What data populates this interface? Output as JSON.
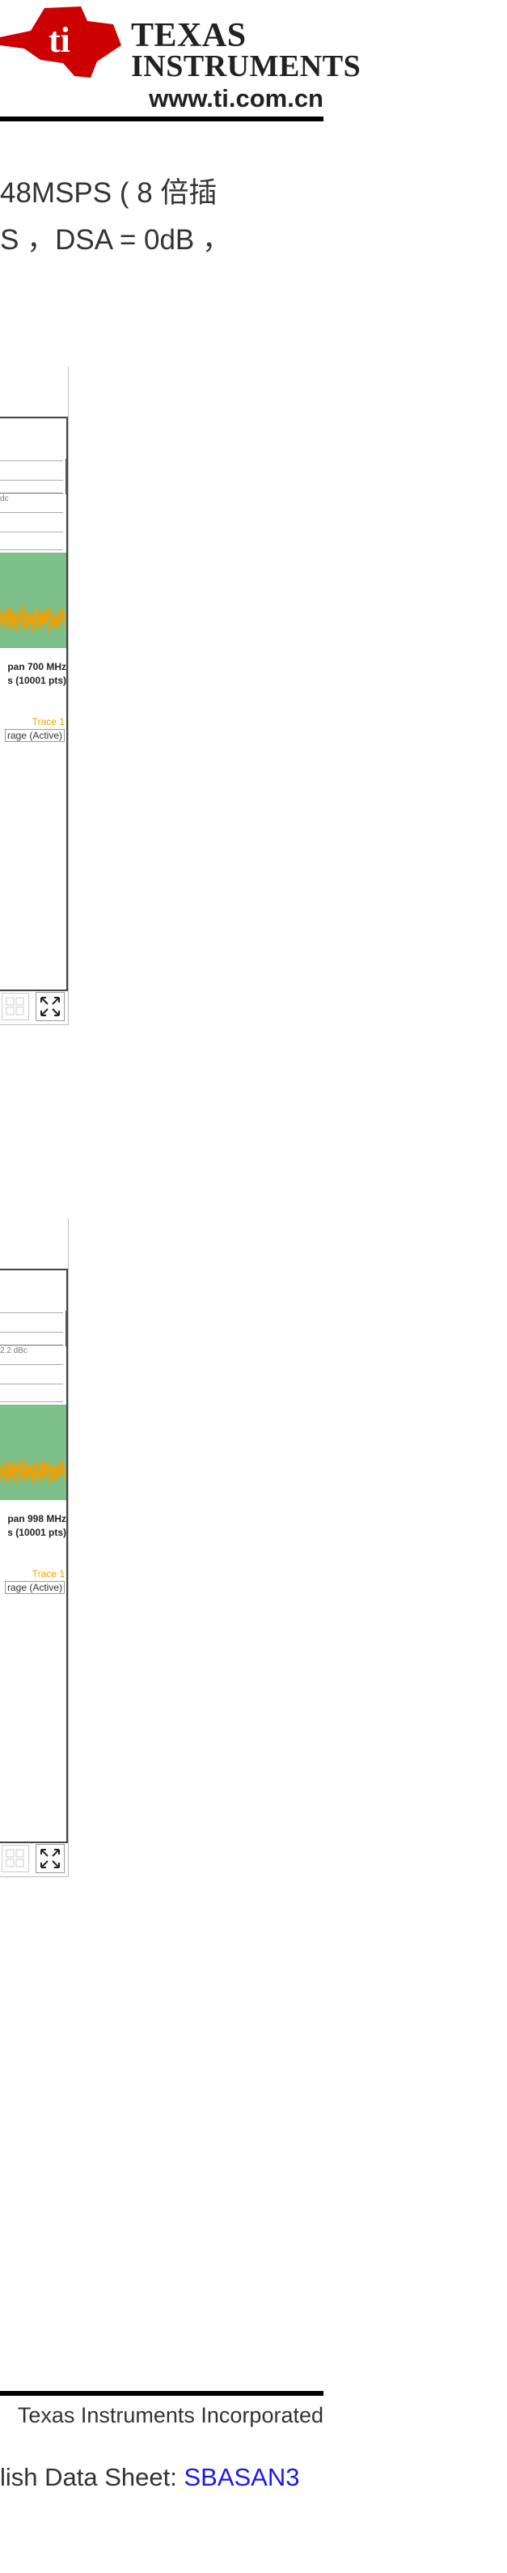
{
  "header": {
    "logo_line1": "TEXAS",
    "logo_line2": "INSTRUMENTS",
    "url": "www.ti.com.cn"
  },
  "body_text": {
    "line1": "48MSPS ( 8 倍插",
    "line2": "S ，DSA = 0dB ，"
  },
  "plots": [
    {
      "limit_label": "dc",
      "span_label": "pan 700 MHz",
      "points_label": "s (10001 pts)",
      "trace_label": "Trace 1",
      "avg_label": "rage (Active)"
    },
    {
      "limit_label": "2.2 dBc",
      "span_label": "pan 998 MHz",
      "points_label": "s (10001 pts)",
      "trace_label": "Trace 1",
      "avg_label": "rage (Active)"
    }
  ],
  "footer": {
    "copyright": "Texas Instruments Incorporated",
    "ds_prefix": "lish Data Sheet: ",
    "ds_link": "SBASAN3"
  },
  "colors": {
    "ti_red": "#cc0000",
    "trace_orange": "#f5a000",
    "band_green": "#7ec08a",
    "link_blue": "#1a1aee"
  },
  "icons": [
    "ti-logo-icon",
    "layout-grid-icon",
    "expand-icon"
  ]
}
